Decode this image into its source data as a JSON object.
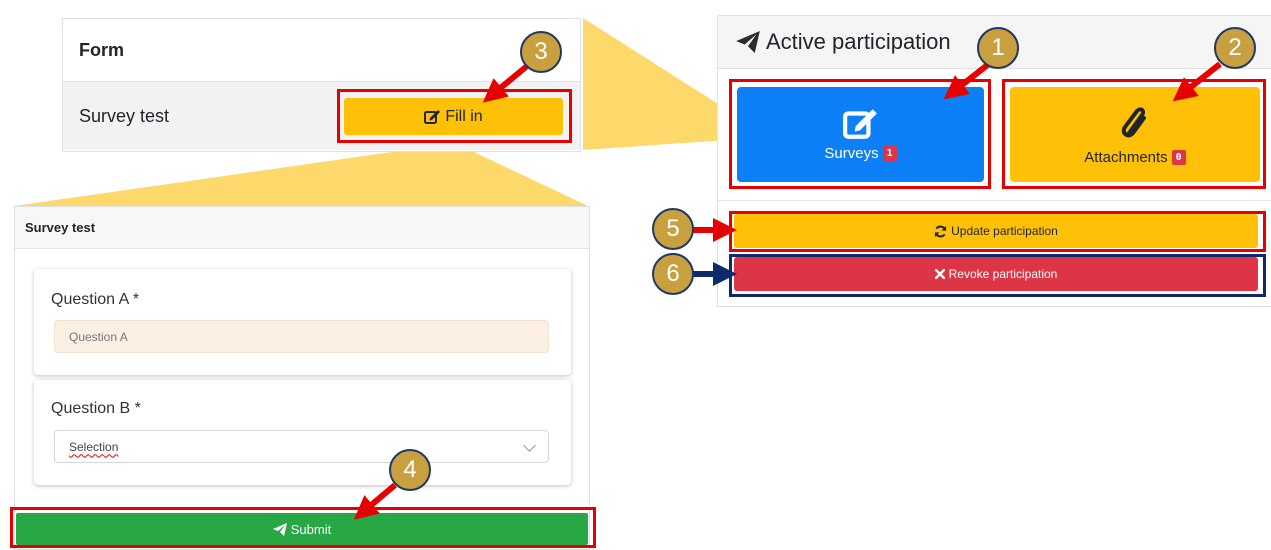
{
  "form_table": {
    "header": "Form",
    "row_label": "Survey test",
    "fill_button_label": "Fill in"
  },
  "survey": {
    "title": "Survey test",
    "question_a": {
      "label": "Question A *",
      "placeholder": "Question A"
    },
    "question_b": {
      "label": "Question B *",
      "value": "Selection"
    },
    "submit_label": "Submit"
  },
  "active_participation": {
    "title": "Active participation",
    "surveys": {
      "label": "Surveys",
      "count": "1"
    },
    "attachments": {
      "label": "Attachments",
      "count": "0"
    },
    "update_label": "Update participation",
    "revoke_label": "Revoke participation"
  },
  "markers": [
    "1",
    "2",
    "3",
    "4",
    "5",
    "6"
  ],
  "colors": {
    "primary": "#0d7ff7",
    "warning": "#ffc107",
    "success": "#28a745",
    "danger": "#dc3545",
    "highlight_frame": "#e60000",
    "callout": "#fcd55a"
  },
  "icons": {
    "fill": "edit-icon",
    "submit": "paper-plane-icon",
    "title": "paper-plane-icon",
    "surveys": "edit-icon",
    "attachments": "paperclip-icon",
    "update": "sync-icon",
    "revoke": "times-icon"
  }
}
